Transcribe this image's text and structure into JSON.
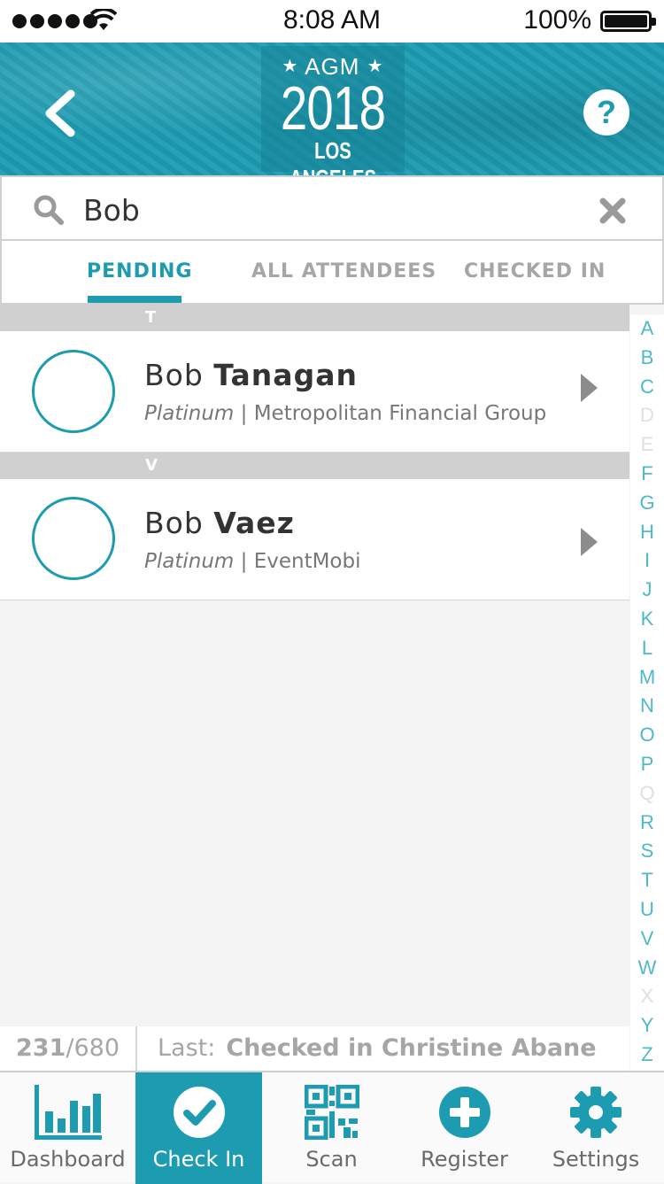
{
  "status_bar": {
    "time": "8:08 AM",
    "battery": "100%"
  },
  "header": {
    "logo_top": "AGM",
    "logo_year": "2018",
    "logo_city": "LOS ANGELES",
    "help_label": "?"
  },
  "search": {
    "value": "Bob",
    "placeholder": ""
  },
  "tabs": [
    {
      "label": "PENDING",
      "active": true
    },
    {
      "label": "ALL ATTENDEES",
      "active": false
    },
    {
      "label": "CHECKED IN",
      "active": false
    }
  ],
  "list": {
    "sections": [
      {
        "letter": "T",
        "attendees": [
          {
            "first": "Bob",
            "last": "Tanagan",
            "tier": "Platinum",
            "separator": "|",
            "company": "Metropolitan Financial Group"
          }
        ]
      },
      {
        "letter": "V",
        "attendees": [
          {
            "first": "Bob",
            "last": "Vaez",
            "tier": "Platinum",
            "separator": "|",
            "company": "EventMobi"
          }
        ]
      }
    ]
  },
  "alpha_index": [
    "A",
    "B",
    "C",
    "D",
    "E",
    "F",
    "G",
    "H",
    "I",
    "J",
    "K",
    "L",
    "M",
    "N",
    "O",
    "P",
    "Q",
    "R",
    "S",
    "T",
    "U",
    "V",
    "W",
    "X",
    "Y",
    "Z"
  ],
  "alpha_disabled": [
    "D",
    "E",
    "Q",
    "X"
  ],
  "counter": {
    "checked": "231",
    "total": "/680",
    "last_label": "Last:",
    "last_value": "Checked in Christine Abane"
  },
  "tabbar": [
    {
      "label": "Dashboard",
      "icon": "bar-chart-icon",
      "active": false
    },
    {
      "label": "Check In",
      "icon": "checkmark-icon",
      "active": true
    },
    {
      "label": "Scan",
      "icon": "qr-code-icon",
      "active": false
    },
    {
      "label": "Register",
      "icon": "plus-circle-icon",
      "active": false
    },
    {
      "label": "Settings",
      "icon": "gear-icon",
      "active": false
    }
  ],
  "colors": {
    "accent": "#1c9bb1",
    "alpha": "#4fb8ca",
    "section": "#d0d0d0"
  }
}
